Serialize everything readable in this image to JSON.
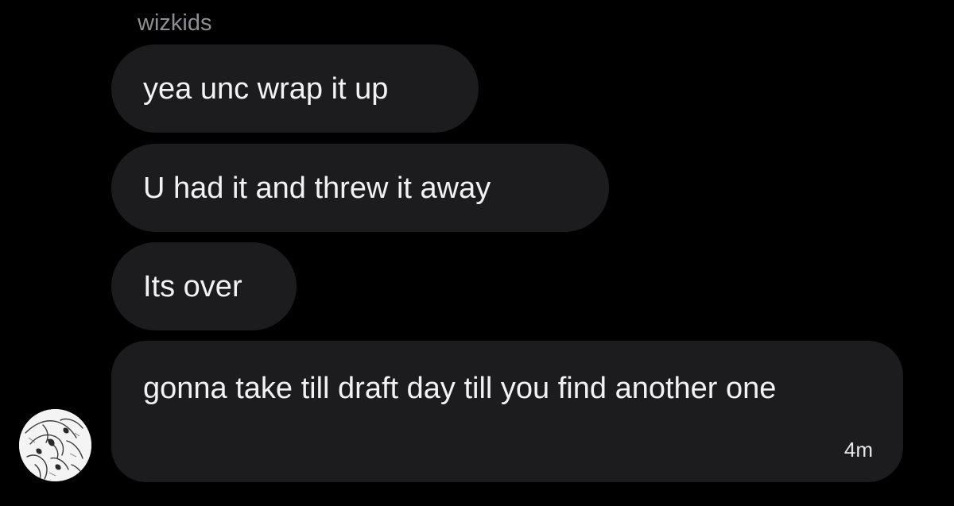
{
  "conversation": {
    "sender_name": "wizkids",
    "messages": [
      {
        "text": "yea unc wrap it up"
      },
      {
        "text": "U had it and threw it away"
      },
      {
        "text": "Its over"
      },
      {
        "text": "gonna take till draft day till you find another one",
        "timestamp": "4m"
      }
    ]
  },
  "avatar": {
    "icon": "sketch-profile-avatar"
  },
  "colors": {
    "background": "#000000",
    "bubble": "#1c1c1e",
    "sender_name": "#8e8e93",
    "text": "#f2f2f2"
  }
}
